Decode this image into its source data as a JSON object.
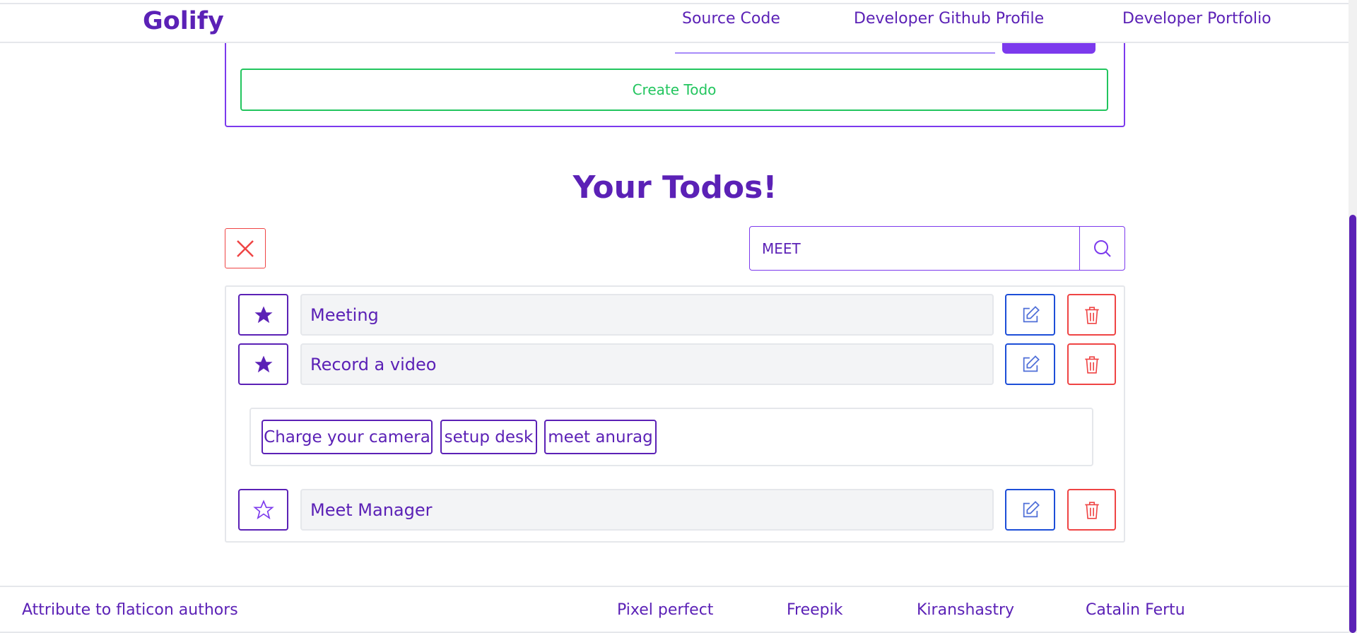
{
  "navbar": {
    "brand": "Golify",
    "links": [
      "Source Code",
      "Developer Github Profile",
      "Developer Portfolio"
    ]
  },
  "create_form": {
    "create_label": "Create Todo"
  },
  "todos": {
    "title": "Your Todos!",
    "search": {
      "value": "MEET",
      "icon": "search-icon"
    },
    "clear_icon": "close-icon",
    "items": [
      {
        "text": "Meeting",
        "starred": true
      },
      {
        "text": "Record a video",
        "starred": true,
        "subtasks": [
          "Charge your camera",
          "setup desk",
          "meet anurag"
        ]
      },
      {
        "text": "Meet Manager",
        "starred": false
      }
    ]
  },
  "footer": {
    "attribution": "Attribute to flaticon authors",
    "authors": [
      "Pixel perfect",
      "Freepik",
      "Kiranshastry",
      "Catalin Fertu"
    ]
  },
  "colors": {
    "primary": "#5b21b6",
    "accent": "#7c3aed",
    "create": "#22c55e",
    "edit": "#1d4ed8",
    "delete": "#ef4444"
  }
}
